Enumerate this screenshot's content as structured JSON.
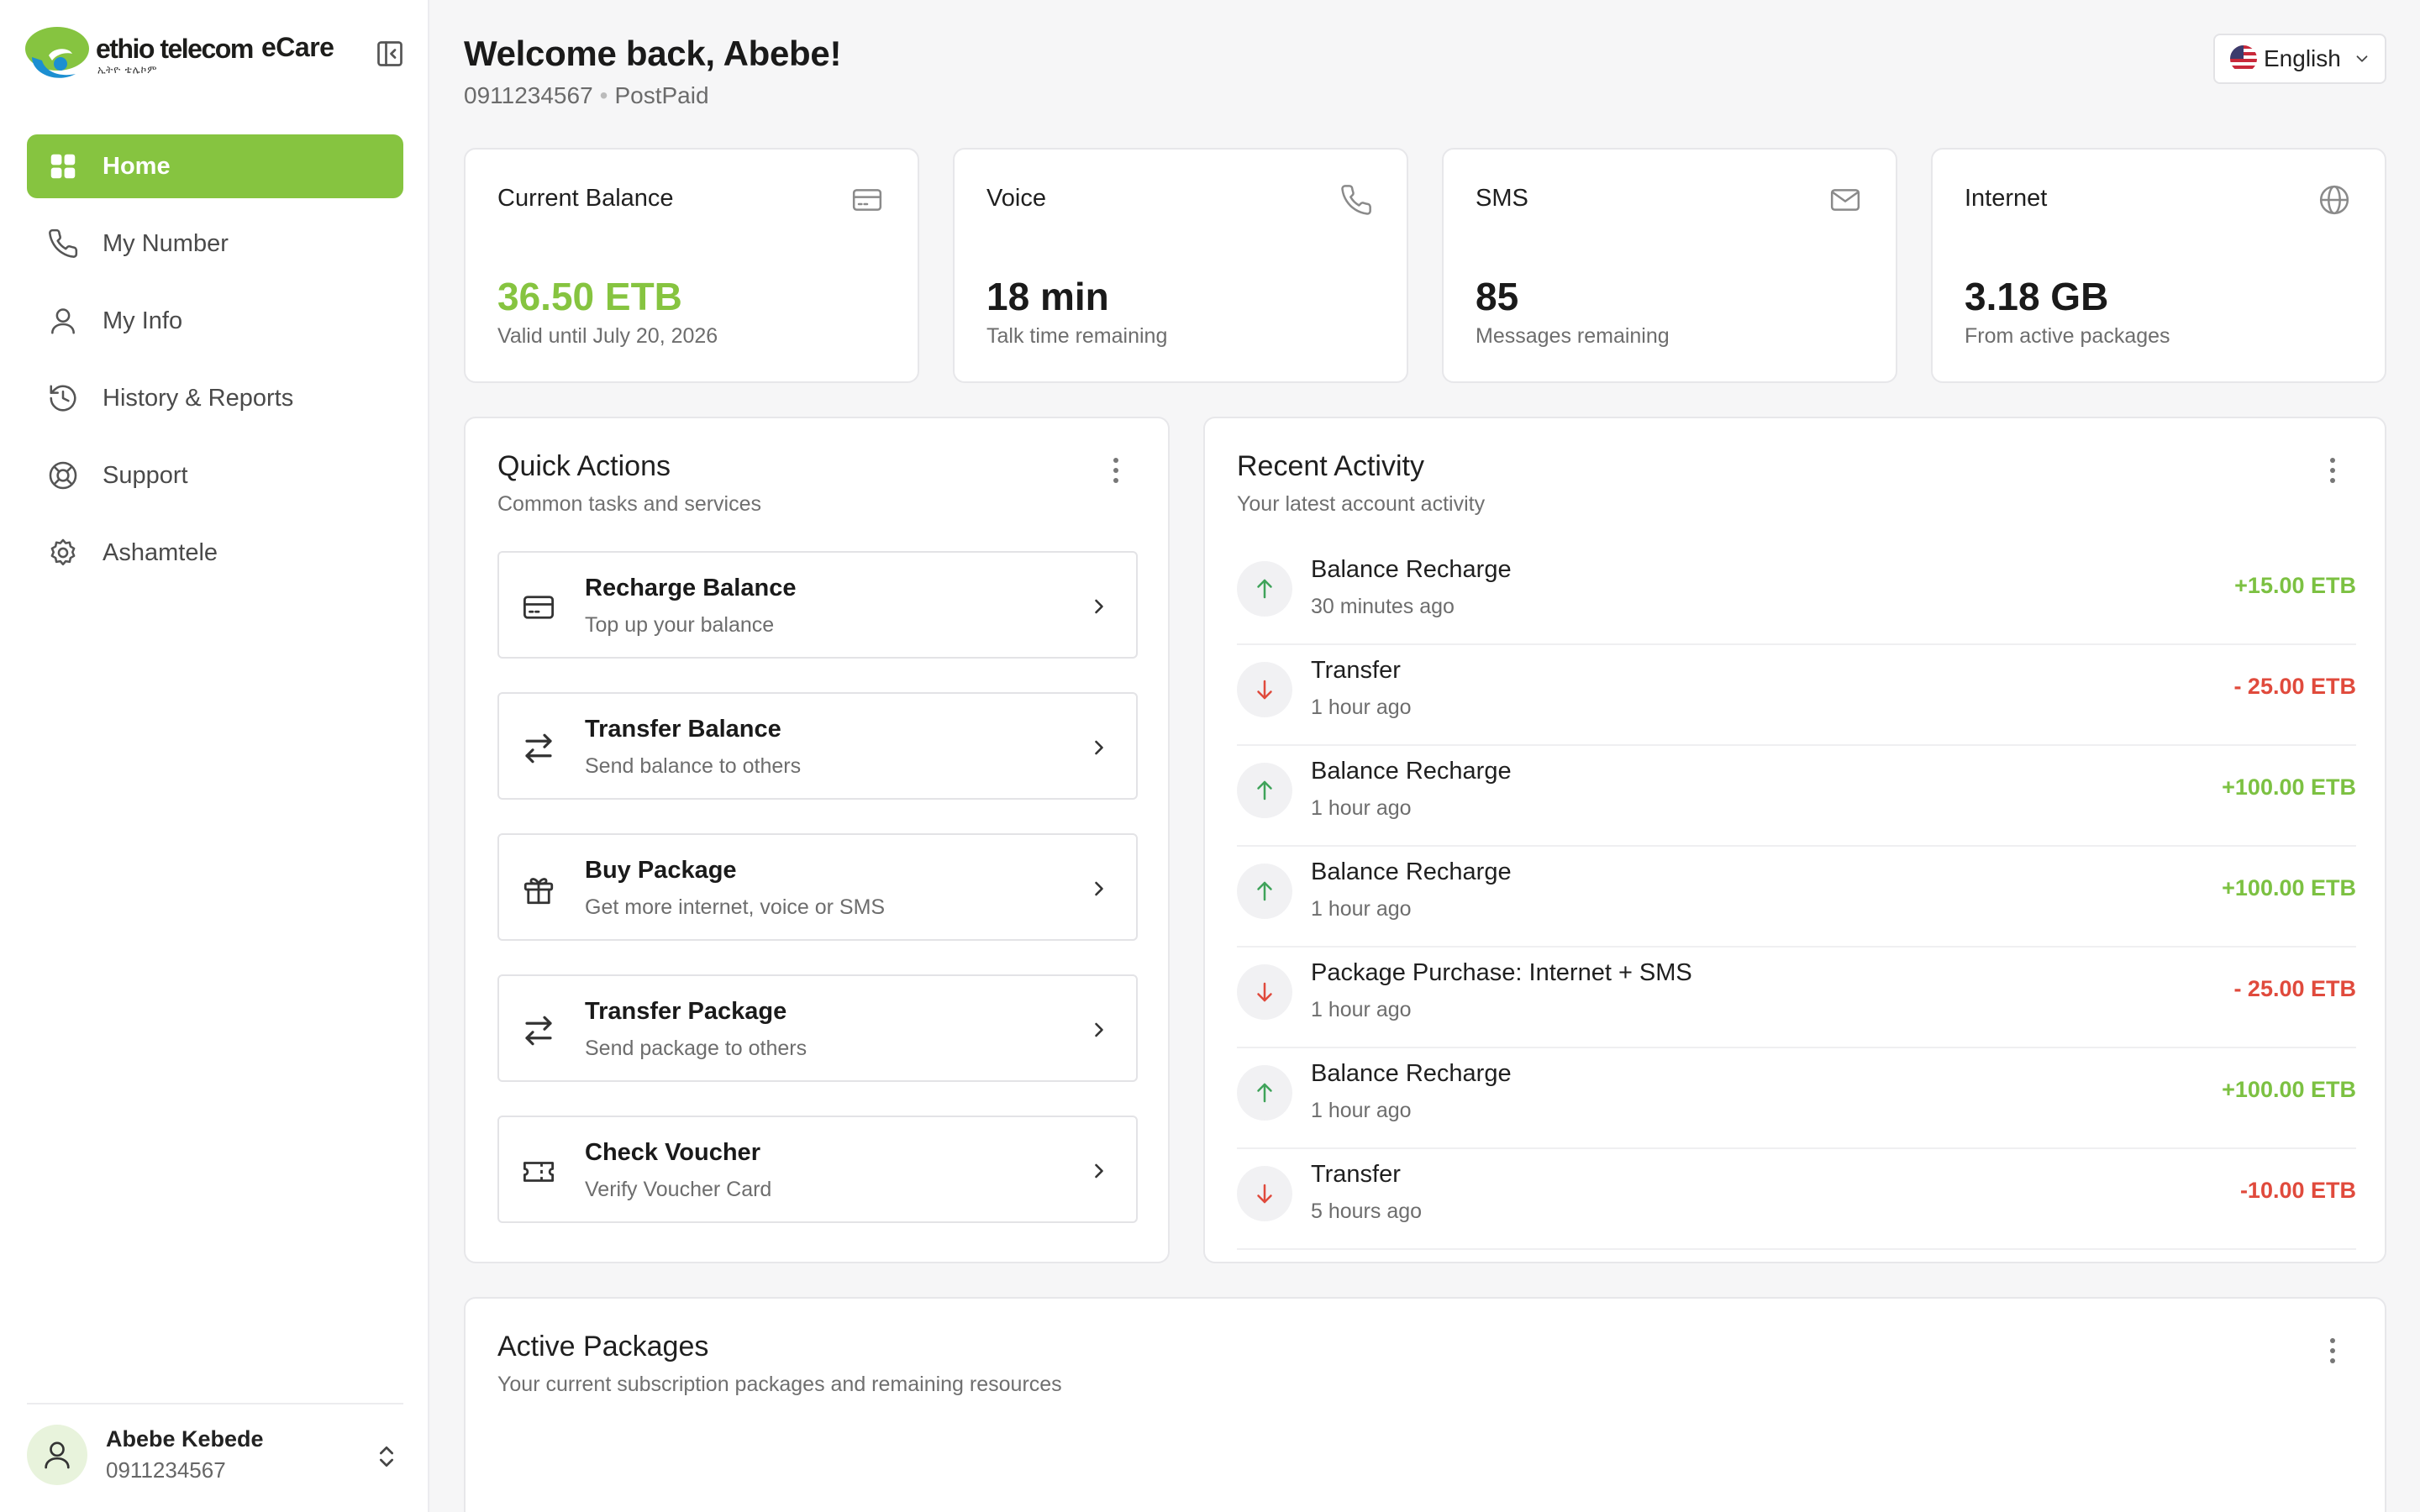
{
  "brand": {
    "name": "ethio telecom",
    "sub": "ኢትዮ ቴሌኮም",
    "product": "eCare",
    "accent": "#86c440"
  },
  "nav": [
    {
      "label": "Home",
      "icon": "grid-icon",
      "active": true
    },
    {
      "label": "My Number",
      "icon": "phone-icon"
    },
    {
      "label": "My Info",
      "icon": "user-icon"
    },
    {
      "label": "History & Reports",
      "icon": "history-icon"
    },
    {
      "label": "Support",
      "icon": "lifebuoy-icon"
    },
    {
      "label": "Ashamtele",
      "icon": "gear-icon"
    }
  ],
  "user": {
    "name": "Abebe Kebede",
    "phone": "0911234567"
  },
  "header": {
    "welcome": "Welcome back, Abebe!",
    "phone": "0911234567",
    "plan": "PostPaid",
    "language": "English"
  },
  "stats": [
    {
      "label": "Current Balance",
      "value": "36.50 ETB",
      "desc": "Valid until July 20, 2026",
      "icon": "card-icon",
      "highlight": true
    },
    {
      "label": "Voice",
      "value": "18 min",
      "desc": "Talk time remaining",
      "icon": "phone-icon"
    },
    {
      "label": "SMS",
      "value": "85",
      "desc": "Messages remaining",
      "icon": "mail-icon"
    },
    {
      "label": "Internet",
      "value": "3.18 GB",
      "desc": "From active packages",
      "icon": "globe-icon"
    }
  ],
  "quick_actions": {
    "title": "Quick Actions",
    "subtitle": "Common tasks and services",
    "items": [
      {
        "title": "Recharge Balance",
        "subtitle": "Top up your balance",
        "icon": "card-icon"
      },
      {
        "title": "Transfer Balance",
        "subtitle": "Send balance to others",
        "icon": "transfer-icon"
      },
      {
        "title": "Buy Package",
        "subtitle": "Get more internet, voice or SMS",
        "icon": "gift-icon"
      },
      {
        "title": "Transfer Package",
        "subtitle": "Send package to others",
        "icon": "transfer-icon"
      },
      {
        "title": "Check Voucher",
        "subtitle": "Verify Voucher Card",
        "icon": "ticket-icon"
      }
    ]
  },
  "recent_activity": {
    "title": "Recent Activity",
    "subtitle": "Your latest account activity",
    "items": [
      {
        "title": "Balance Recharge",
        "time": "30 minutes ago",
        "amount": "+15.00 ETB",
        "direction": "in"
      },
      {
        "title": "Transfer",
        "time": "1 hour ago",
        "amount": "- 25.00 ETB",
        "direction": "out"
      },
      {
        "title": "Balance Recharge",
        "time": "1 hour ago",
        "amount": "+100.00 ETB",
        "direction": "in"
      },
      {
        "title": "Balance Recharge",
        "time": "1 hour ago",
        "amount": "+100.00 ETB",
        "direction": "in"
      },
      {
        "title": "Package Purchase: Internet + SMS",
        "time": "1 hour ago",
        "amount": "- 25.00 ETB",
        "direction": "out"
      },
      {
        "title": "Balance Recharge",
        "time": "1 hour ago",
        "amount": "+100.00 ETB",
        "direction": "in"
      },
      {
        "title": "Transfer",
        "time": "5 hours ago",
        "amount": "-10.00 ETB",
        "direction": "out"
      }
    ]
  },
  "active_packages": {
    "title": "Active Packages",
    "subtitle": "Your current subscription packages and remaining resources"
  }
}
